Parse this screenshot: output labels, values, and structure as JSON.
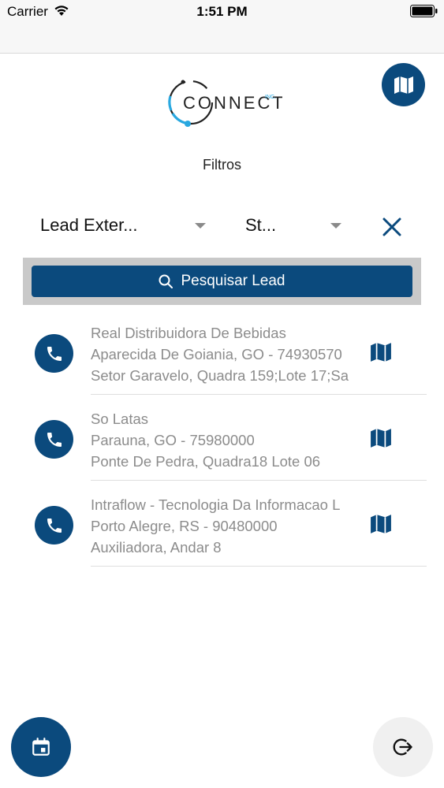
{
  "status_bar": {
    "carrier": "Carrier",
    "time": "1:51 PM",
    "wifi_icon": "wifi-icon",
    "battery_icon": "battery-icon"
  },
  "header": {
    "logo_text": "CONNECT",
    "logo_suffix": "INC.",
    "map_icon": "map-icon"
  },
  "filters": {
    "title": "Filtros",
    "lead_dropdown_value": "Lead Exter...",
    "status_dropdown_value": "St...",
    "clear_icon": "close-icon"
  },
  "search": {
    "label": "Pesquisar Lead",
    "icon": "search-icon"
  },
  "leads": [
    {
      "name": "Real Distribuidora De Bebidas",
      "city": "Aparecida De Goiania, GO - 74930570",
      "address": "Setor Garavelo, Quadra 159;Lote 17;Sa"
    },
    {
      "name": "So Latas",
      "city": "Parauna, GO - 75980000",
      "address": "Ponte De Pedra, Quadra18 Lote 06"
    },
    {
      "name": "Intraflow - Tecnologia Da Informacao L",
      "city": "Porto Alegre, RS - 90480000",
      "address": "Auxiliadora, Andar 8"
    }
  ],
  "bottom": {
    "calendar_icon": "calendar-icon",
    "logout_icon": "logout-icon"
  },
  "colors": {
    "primary": "#0b4a7d",
    "muted_text": "#8c8c8c",
    "search_bg": "#c9c9c9",
    "logo_accent": "#29a8e0"
  }
}
